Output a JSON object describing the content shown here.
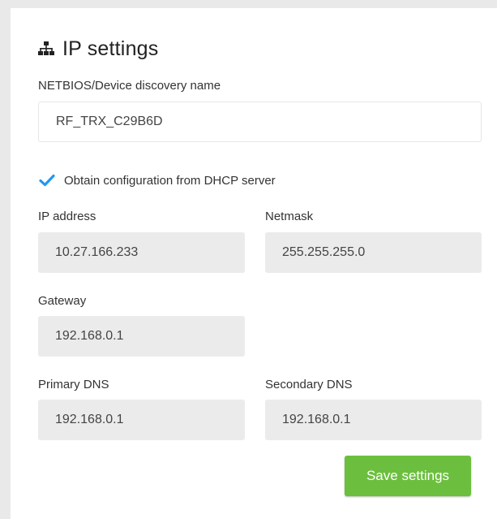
{
  "panel": {
    "title": "IP settings",
    "title_icon": "network-icon"
  },
  "netbios": {
    "label": "NETBIOS/Device discovery name",
    "value": "RF_TRX_C29B6D"
  },
  "dhcp": {
    "checked": true,
    "label": "Obtain configuration from DHCP server"
  },
  "ip_address": {
    "label": "IP address",
    "value": "10.27.166.233"
  },
  "netmask": {
    "label": "Netmask",
    "value": "255.255.255.0"
  },
  "gateway": {
    "label": "Gateway",
    "value": "192.168.0.1"
  },
  "primary_dns": {
    "label": "Primary DNS",
    "value": "192.168.0.1"
  },
  "secondary_dns": {
    "label": "Secondary DNS",
    "value": "192.168.0.1"
  },
  "actions": {
    "save_label": "Save settings"
  },
  "colors": {
    "accent_check": "#2196f3",
    "save_button": "#6cbf3e",
    "disabled_field": "#ebebeb"
  }
}
